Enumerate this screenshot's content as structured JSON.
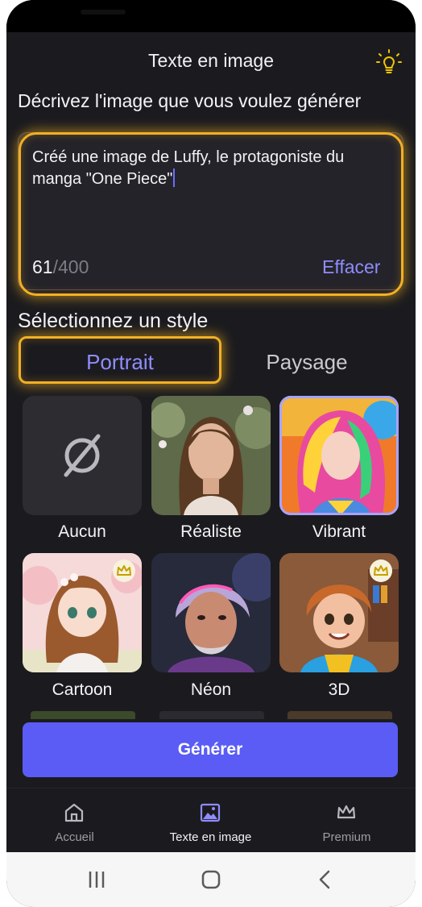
{
  "header": {
    "title": "Texte en image"
  },
  "prompt": {
    "heading": "Décrivez l'image que vous voulez générer",
    "text": "Créé une image de Luffy, le protagoniste du manga \"One Piece\"",
    "count": "61",
    "max": "/400",
    "clear_label": "Effacer"
  },
  "style": {
    "heading": "Sélectionnez un style",
    "tabs": [
      {
        "label": "Portrait",
        "active": true
      },
      {
        "label": "Paysage",
        "active": false
      }
    ],
    "items": [
      {
        "label": "Aucun",
        "premium": false,
        "selected": false
      },
      {
        "label": "Réaliste",
        "premium": false,
        "selected": false
      },
      {
        "label": "Vibrant",
        "premium": false,
        "selected": true
      },
      {
        "label": "Cartoon",
        "premium": true,
        "selected": false
      },
      {
        "label": "Néon",
        "premium": false,
        "selected": false
      },
      {
        "label": "3D",
        "premium": true,
        "selected": false
      }
    ]
  },
  "generate": {
    "label": "Générer"
  },
  "nav": {
    "items": [
      {
        "label": "Accueil",
        "icon": "home-icon",
        "active": false
      },
      {
        "label": "Texte en image",
        "icon": "image-icon",
        "active": true
      },
      {
        "label": "Premium",
        "icon": "crown-icon",
        "active": false
      }
    ]
  },
  "colors": {
    "accent": "#8f8cff",
    "button": "#5a5cf5",
    "highlight": "#f2b023",
    "background": "#1b1b1f"
  }
}
